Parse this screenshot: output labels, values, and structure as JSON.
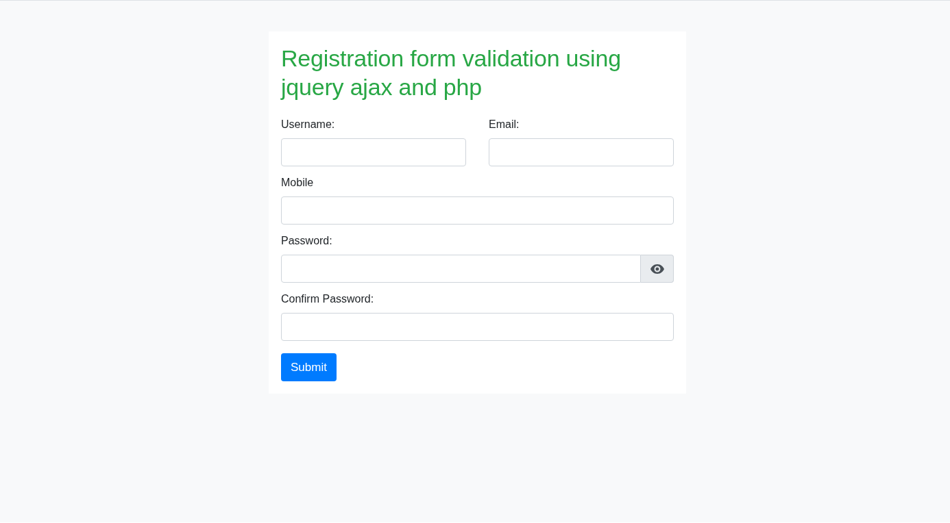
{
  "form": {
    "title": "Registration form validation using jquery ajax and php",
    "fields": [
      {
        "kind": "half",
        "label": "Username:"
      },
      {
        "kind": "half",
        "label": "Email:"
      },
      {
        "kind": "full",
        "label": "Mobile"
      },
      {
        "kind": "password",
        "label": "Password:"
      },
      {
        "kind": "full",
        "label": "Confirm Password:"
      }
    ],
    "submit": "Submit"
  }
}
